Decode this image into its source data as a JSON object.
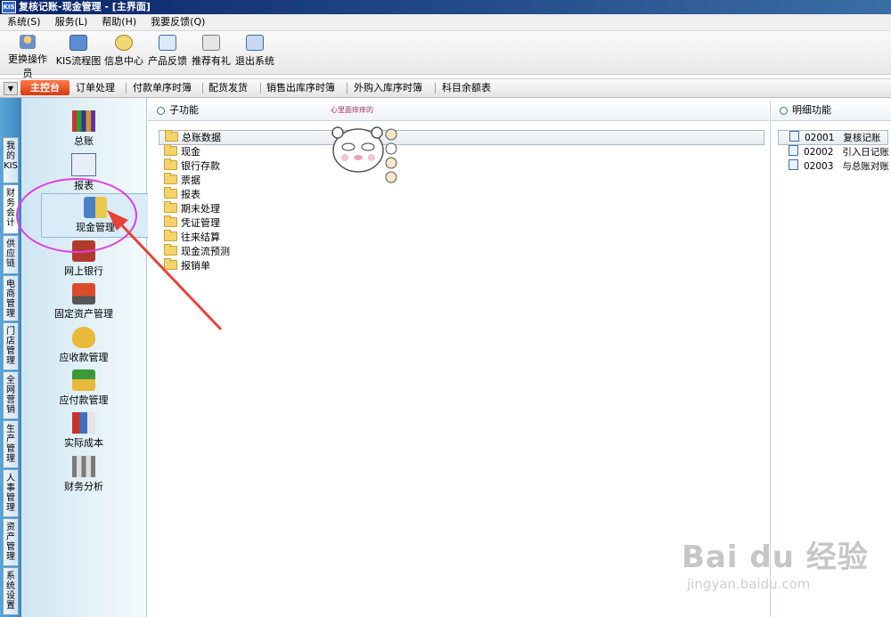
{
  "window": {
    "title": "复核记账-现金管理 - [主界面]",
    "logo": "KIS"
  },
  "menu": [
    "系统(S)",
    "服务(L)",
    "帮助(H)",
    "我要反馈(Q)"
  ],
  "toolbar": [
    {
      "label": "更换操作员",
      "icon": "user-switch-icon"
    },
    {
      "label": "KIS流程图",
      "icon": "flowchart-icon"
    },
    {
      "label": "信息中心",
      "icon": "message-icon"
    },
    {
      "label": "产品反馈",
      "icon": "feedback-icon"
    },
    {
      "label": "推荐有礼",
      "icon": "gift-icon"
    },
    {
      "label": "退出系统",
      "icon": "exit-icon"
    }
  ],
  "nav": {
    "home": "主控台",
    "items": [
      "订单处理",
      "付款单序时簿",
      "配货发货",
      "销售出库序时簿",
      "外购入库序时簿",
      "科目余额表"
    ]
  },
  "vtabs": [
    "我的KIS",
    "财务会计",
    "供应链",
    "电商管理",
    "门店管理",
    "全网营销",
    "生产管理",
    "人事管理",
    "资产管理",
    "系统设置"
  ],
  "left_items": [
    {
      "label": "总账",
      "icon": "books-icon"
    },
    {
      "label": "报表",
      "icon": "report-icon"
    },
    {
      "label": "现金管理",
      "icon": "cash-icon"
    },
    {
      "label": "网上银行",
      "icon": "bank-icon"
    },
    {
      "label": "固定资产管理",
      "icon": "truck-icon"
    },
    {
      "label": "应收款管理",
      "icon": "money-bag-icon"
    },
    {
      "label": "应付款管理",
      "icon": "payable-icon"
    },
    {
      "label": "实际成本",
      "icon": "cube-icon"
    },
    {
      "label": "财务分析",
      "icon": "analysis-icon"
    }
  ],
  "sub_functions": {
    "title": "子功能",
    "items": [
      "总账数据",
      "现金",
      "银行存款",
      "票据",
      "报表",
      "期末处理",
      "凭证管理",
      "往来结算",
      "现金流预测",
      "报销单"
    ]
  },
  "details": {
    "title": "明细功能",
    "items": [
      {
        "code": "02001",
        "name": "复核记账"
      },
      {
        "code": "02002",
        "name": "引入日记账"
      },
      {
        "code": "02003",
        "name": "与总账对账"
      }
    ]
  },
  "sticker_text": "心里面痒痒的",
  "watermark": {
    "brand": "Bai du 经验",
    "url": "jingyan.baidu.com"
  },
  "colors": {
    "accent": "#d43a10",
    "annotation": "#e23de0",
    "arrow": "#e8423a"
  }
}
